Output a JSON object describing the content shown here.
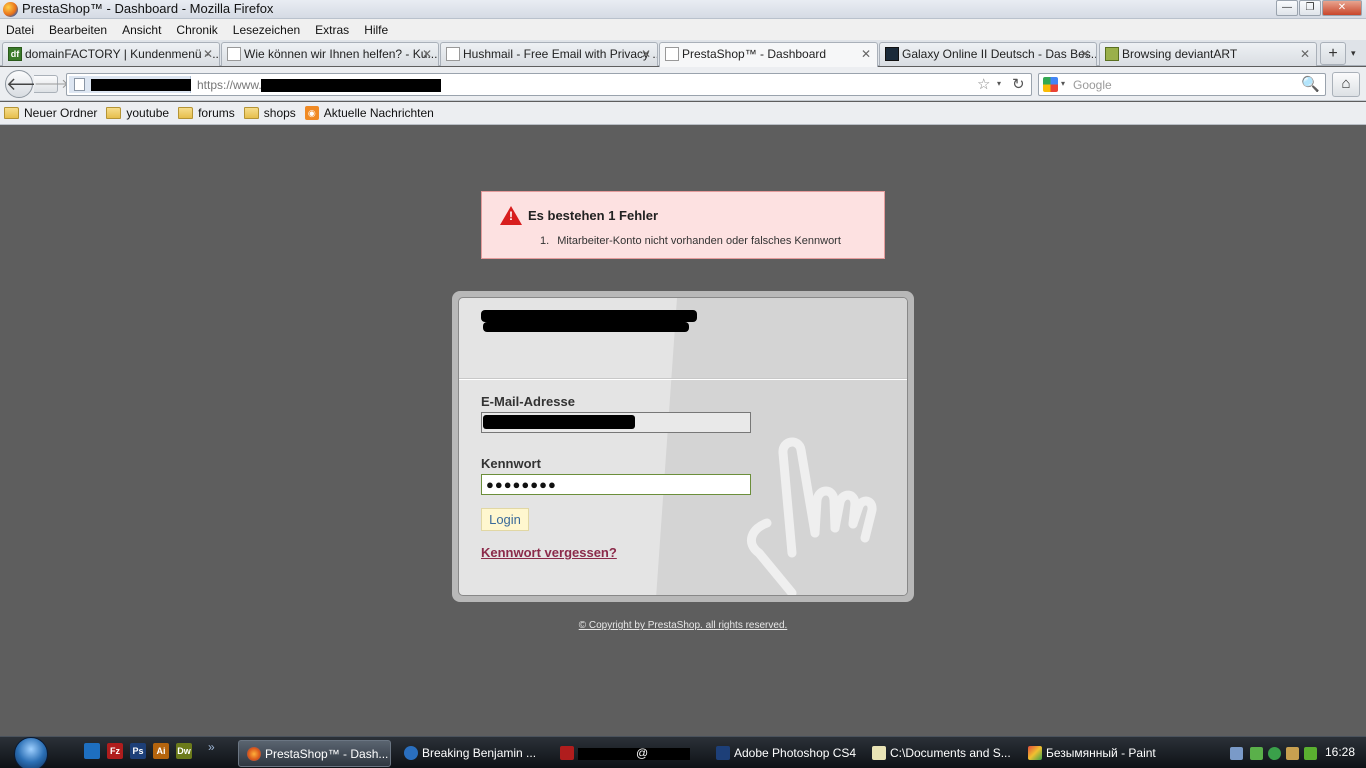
{
  "window": {
    "title": "PrestaShop™ - Dashboard - Mozilla Firefox",
    "buttons": {
      "minimize": "—",
      "maximize": "❐",
      "close": "✕"
    }
  },
  "menu": [
    "Datei",
    "Bearbeiten",
    "Ansicht",
    "Chronik",
    "Lesezeichen",
    "Extras",
    "Hilfe"
  ],
  "tabs": [
    {
      "label": "domainFACTORY | Kundenmenü - ...",
      "active": false
    },
    {
      "label": "Wie können wir Ihnen helfen? - Ku...",
      "active": false
    },
    {
      "label": "Hushmail - Free Email with Privacy ...",
      "active": false
    },
    {
      "label": "PrestaShop™ - Dashboard",
      "active": true
    },
    {
      "label": "Galaxy Online II Deutsch - Das Bes...",
      "active": false
    },
    {
      "label": "Browsing deviantART",
      "active": false
    }
  ],
  "tab_extra": {
    "new_tab": "+",
    "list": "▾",
    "close": "✕",
    "df_favicon": "df"
  },
  "nav": {
    "back": "🡐",
    "forward": "🡒",
    "url_prefix": "https://www.",
    "star": "☆",
    "dropmarker": "▾",
    "reload": "↻",
    "search_placeholder": "Google",
    "search_icon": "🔍",
    "home": "⌂"
  },
  "bookmarks": [
    "Neuer Ordner",
    "youtube",
    "forums",
    "shops",
    "Aktuelle Nachrichten"
  ],
  "error": {
    "title": "Es bestehen 1 Fehler",
    "items": [
      {
        "num": "1.",
        "text": "Mitarbeiter-Konto nicht vorhanden oder falsches Kennwort"
      }
    ]
  },
  "login": {
    "email_label": "E-Mail-Adresse",
    "password_label": "Kennwort",
    "password_value": "●●●●●●●●",
    "button": "Login",
    "forgot": "Kennwort vergessen?"
  },
  "footer": {
    "copyright": "© Copyright by PrestaShop. all rights reserved."
  },
  "taskbar": {
    "quick_more": "»",
    "quick_labels": {
      "filezilla": "Fz",
      "photoshop": "Ps",
      "illustrator": "Ai",
      "dreamweaver": "Dw"
    },
    "tasks": [
      {
        "label": "PrestaShop™ - Dash...",
        "active": true
      },
      {
        "label": "Breaking Benjamin   ...",
        "active": false
      },
      {
        "label": "@",
        "active": false
      },
      {
        "label": "Adobe Photoshop CS4",
        "active": false
      },
      {
        "label": "C:\\Documents and S...",
        "active": false
      },
      {
        "label": "Безымянный - Paint",
        "active": false
      }
    ],
    "clock": "16:28"
  }
}
